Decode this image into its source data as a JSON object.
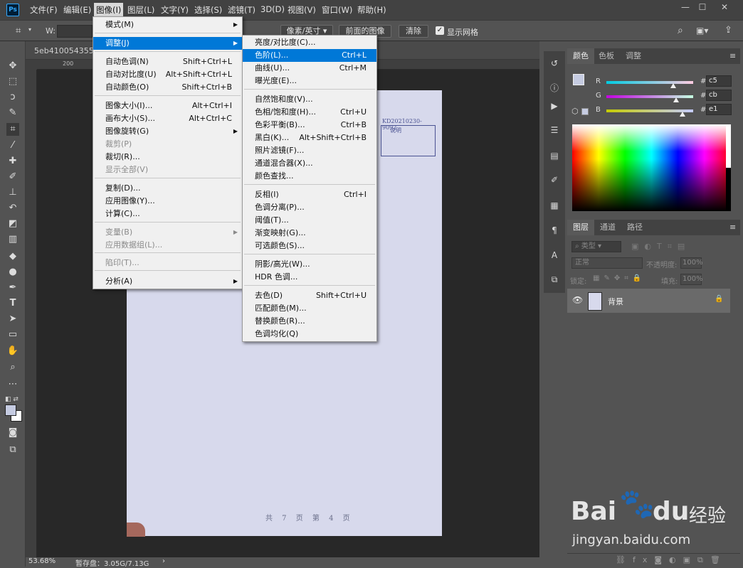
{
  "app": {
    "logo": "Ps"
  },
  "menubar": {
    "items": [
      "文件(F)",
      "编辑(E)",
      "图像(I)",
      "图层(L)",
      "文字(Y)",
      "选择(S)",
      "滤镜(T)",
      "3D(D)",
      "视图(V)",
      "窗口(W)",
      "帮助(H)"
    ]
  },
  "window_controls": {
    "minimize": "—",
    "maximize": "☐",
    "close": "✕"
  },
  "options": {
    "w_label": "W:",
    "unit_select": "像素/英寸",
    "front_image": "前面的图像",
    "clear": "清除",
    "grid_checkbox": "显示网格",
    "grid_checked": true
  },
  "document": {
    "tab_label": "5eb41005435512",
    "ruler_tick": "200",
    "stamp_code": "KD20210230-9092",
    "stamp_label": "说明",
    "page_footer": "共 7 页 第 4 页"
  },
  "status": {
    "zoom": "53.68%",
    "scratch": "暂存盘：3.05G/7.13G",
    "arrow": "›"
  },
  "image_menu": {
    "items": [
      {
        "label": "模式(M)",
        "shortcut": "",
        "submenu": true,
        "disabled": false
      },
      {
        "label": "调整(J)",
        "shortcut": "",
        "submenu": true,
        "disabled": false,
        "highlight": true
      },
      {
        "label": "自动色调(N)",
        "shortcut": "Shift+Ctrl+L",
        "submenu": false,
        "disabled": false
      },
      {
        "label": "自动对比度(U)",
        "shortcut": "Alt+Shift+Ctrl+L",
        "submenu": false,
        "disabled": false
      },
      {
        "label": "自动颜色(O)",
        "shortcut": "Shift+Ctrl+B",
        "submenu": false,
        "disabled": false
      },
      {
        "label": "图像大小(I)...",
        "shortcut": "Alt+Ctrl+I",
        "submenu": false,
        "disabled": false
      },
      {
        "label": "画布大小(S)...",
        "shortcut": "Alt+Ctrl+C",
        "submenu": false,
        "disabled": false
      },
      {
        "label": "图像旋转(G)",
        "shortcut": "",
        "submenu": true,
        "disabled": false
      },
      {
        "label": "裁剪(P)",
        "shortcut": "",
        "submenu": false,
        "disabled": true
      },
      {
        "label": "裁切(R)...",
        "shortcut": "",
        "submenu": false,
        "disabled": false
      },
      {
        "label": "显示全部(V)",
        "shortcut": "",
        "submenu": false,
        "disabled": true
      },
      {
        "label": "复制(D)...",
        "shortcut": "",
        "submenu": false,
        "disabled": false
      },
      {
        "label": "应用图像(Y)...",
        "shortcut": "",
        "submenu": false,
        "disabled": false
      },
      {
        "label": "计算(C)...",
        "shortcut": "",
        "submenu": false,
        "disabled": false
      },
      {
        "label": "变量(B)",
        "shortcut": "",
        "submenu": true,
        "disabled": true
      },
      {
        "label": "应用数据组(L)...",
        "shortcut": "",
        "submenu": false,
        "disabled": true
      },
      {
        "label": "陷印(T)...",
        "shortcut": "",
        "submenu": false,
        "disabled": true
      },
      {
        "label": "分析(A)",
        "shortcut": "",
        "submenu": true,
        "disabled": false
      }
    ]
  },
  "adjust_menu": {
    "items": [
      {
        "label": "亮度/对比度(C)...",
        "shortcut": ""
      },
      {
        "label": "色阶(L)...",
        "shortcut": "Ctrl+L",
        "highlight": true
      },
      {
        "label": "曲线(U)...",
        "shortcut": "Ctrl+M"
      },
      {
        "label": "曝光度(E)...",
        "shortcut": ""
      },
      {
        "label": "自然饱和度(V)...",
        "shortcut": ""
      },
      {
        "label": "色相/饱和度(H)...",
        "shortcut": "Ctrl+U"
      },
      {
        "label": "色彩平衡(B)...",
        "shortcut": "Ctrl+B"
      },
      {
        "label": "黑白(K)...",
        "shortcut": "Alt+Shift+Ctrl+B"
      },
      {
        "label": "照片滤镜(F)...",
        "shortcut": ""
      },
      {
        "label": "通道混合器(X)...",
        "shortcut": ""
      },
      {
        "label": "颜色查找...",
        "shortcut": ""
      },
      {
        "label": "反相(I)",
        "shortcut": "Ctrl+I"
      },
      {
        "label": "色调分离(P)...",
        "shortcut": ""
      },
      {
        "label": "阈值(T)...",
        "shortcut": ""
      },
      {
        "label": "渐变映射(G)...",
        "shortcut": ""
      },
      {
        "label": "可选颜色(S)...",
        "shortcut": ""
      },
      {
        "label": "阴影/高光(W)...",
        "shortcut": ""
      },
      {
        "label": "HDR 色调...",
        "shortcut": ""
      },
      {
        "label": "去色(D)",
        "shortcut": "Shift+Ctrl+U"
      },
      {
        "label": "匹配颜色(M)...",
        "shortcut": ""
      },
      {
        "label": "替换颜色(R)...",
        "shortcut": ""
      },
      {
        "label": "色调均化(Q)",
        "shortcut": ""
      }
    ]
  },
  "color_panel": {
    "tabs": [
      "颜色",
      "色板",
      "调整"
    ],
    "rows": [
      {
        "label": "R",
        "value": "c5",
        "level": 0.77,
        "gradient": "linear-gradient(to right,#00cbe1,#ffcbe1)"
      },
      {
        "label": "G",
        "value": "cb",
        "level": 0.8,
        "gradient": "linear-gradient(to right,#c500e1,#c5ffe1)"
      },
      {
        "label": "B",
        "value": "e1",
        "level": 0.88,
        "gradient": "linear-gradient(to right,#c5cb00,#c5cbff)"
      }
    ],
    "hash": "#",
    "fg_color": "#c5cbe1"
  },
  "layers_panel": {
    "tabs": [
      "图层",
      "通道",
      "路径"
    ],
    "filter_placeholder": "类型",
    "blend_mode": "正常",
    "opacity_label": "不透明度:",
    "opacity_value": "100%",
    "lock_label": "锁定:",
    "fill_label": "填充:",
    "fill_value": "100%",
    "layer_name": "背景"
  },
  "watermark": {
    "brand": "Bai",
    "brand2": "du",
    "cn": "经验",
    "url": "jingyan.baidu.com"
  }
}
